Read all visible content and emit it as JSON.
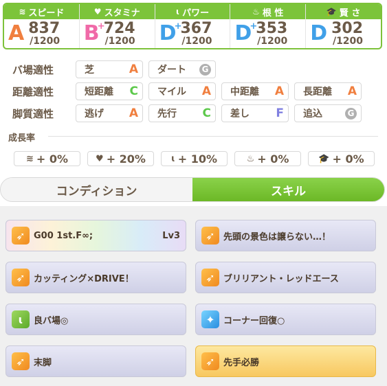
{
  "stats": [
    {
      "label": "スピード",
      "icon": "speed-icon",
      "glyph": "≋",
      "grade": "A",
      "plus": "",
      "value": "837",
      "max": "/1200"
    },
    {
      "label": "スタミナ",
      "icon": "heart-icon",
      "glyph": "♥",
      "grade": "B",
      "plus": "+",
      "value": "724",
      "max": "/1200"
    },
    {
      "label": "パワー",
      "icon": "arm-icon",
      "glyph": "ɩ",
      "grade": "D",
      "plus": "+",
      "value": "367",
      "max": "/1200"
    },
    {
      "label": "根 性",
      "icon": "flame-icon",
      "glyph": "♨",
      "grade": "D",
      "plus": "+",
      "value": "353",
      "max": "/1200"
    },
    {
      "label": "賢 さ",
      "icon": "graduation-cap-icon",
      "glyph": "🎓",
      "grade": "D",
      "plus": "",
      "value": "302",
      "max": "/1200"
    }
  ],
  "aptitudes": {
    "track": {
      "label": "バ場適性",
      "items": [
        {
          "name": "芝",
          "grade": "A"
        },
        {
          "name": "ダート",
          "grade": "G"
        }
      ]
    },
    "distance": {
      "label": "距離適性",
      "items": [
        {
          "name": "短距離",
          "grade": "C"
        },
        {
          "name": "マイル",
          "grade": "A"
        },
        {
          "name": "中距離",
          "grade": "A"
        },
        {
          "name": "長距離",
          "grade": "A"
        }
      ]
    },
    "style": {
      "label": "脚質適性",
      "items": [
        {
          "name": "逃げ",
          "grade": "A"
        },
        {
          "name": "先行",
          "grade": "C"
        },
        {
          "name": "差し",
          "grade": "F"
        },
        {
          "name": "追込",
          "grade": "G"
        }
      ]
    }
  },
  "growth": {
    "title": "成長率",
    "items": [
      {
        "icon": "speed-icon",
        "glyph": "≋",
        "value": "+ 0%"
      },
      {
        "icon": "heart-icon",
        "glyph": "♥",
        "value": "+ 20%"
      },
      {
        "icon": "arm-icon",
        "glyph": "ɩ",
        "value": "+ 10%"
      },
      {
        "icon": "flame-icon",
        "glyph": "♨",
        "value": "+ 0%"
      },
      {
        "icon": "graduation-cap-icon",
        "glyph": "🎓",
        "value": "+ 0%"
      }
    ]
  },
  "tabs": {
    "condition": "コンディション",
    "skill": "スキル",
    "active": "skill"
  },
  "skills": [
    {
      "name": "G00 1st.F∞;",
      "level": "Lv3",
      "style": "rainbow",
      "icon": "speed-skill-icon",
      "icon_color": "orange"
    },
    {
      "name": "先頭の景色は譲らない…！",
      "level": "",
      "style": "normal",
      "icon": "speed-skill-icon",
      "icon_color": "orange"
    },
    {
      "name": "カッティング×DRIVE！",
      "level": "",
      "style": "normal",
      "icon": "speed-skill-icon",
      "icon_color": "orange"
    },
    {
      "name": "ブリリアント・レッドエース",
      "level": "",
      "style": "normal",
      "icon": "speed-skill-icon",
      "icon_color": "orange"
    },
    {
      "name": "良バ場◎",
      "level": "",
      "style": "normal",
      "icon": "power-skill-icon",
      "icon_color": "green"
    },
    {
      "name": "コーナー回復○",
      "level": "",
      "style": "normal",
      "icon": "recovery-skill-icon",
      "icon_color": "blue"
    },
    {
      "name": "末脚",
      "level": "",
      "style": "normal",
      "icon": "speed-skill-icon",
      "icon_color": "orange"
    },
    {
      "name": "先手必勝",
      "level": "",
      "style": "gold",
      "icon": "speed-skill-icon",
      "icon_color": "orange"
    }
  ],
  "colors": {
    "accent_green": "#7cc43a",
    "grade_A": "#f07f3f",
    "grade_B": "#f06aa8",
    "grade_C": "#5cc84a",
    "grade_D": "#40a0e8",
    "grade_F": "#8080e0",
    "grade_G": "#b0b0b0"
  }
}
